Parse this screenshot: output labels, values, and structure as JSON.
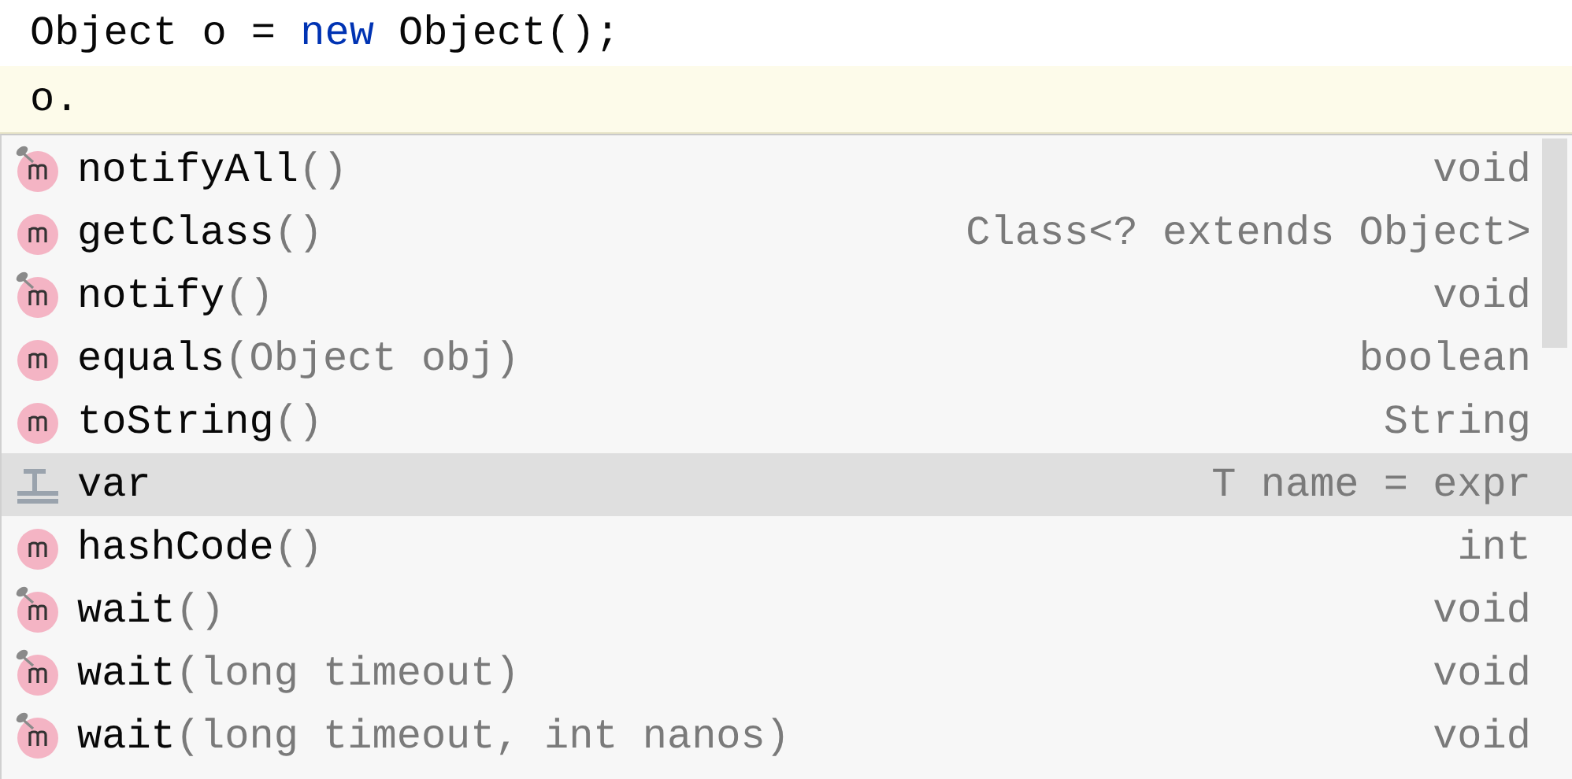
{
  "editor": {
    "lines": [
      {
        "tokens": [
          {
            "text": "Object o = ",
            "kind": "plain"
          },
          {
            "text": "new",
            "kind": "keyword"
          },
          {
            "text": " Object();",
            "kind": "plain"
          }
        ],
        "current": false
      },
      {
        "tokens": [
          {
            "text": "o.",
            "kind": "plain"
          }
        ],
        "current": true
      }
    ]
  },
  "completion": {
    "items": [
      {
        "kind": "method",
        "final": true,
        "name": "notifyAll",
        "params": "()",
        "type": "void",
        "selected": false
      },
      {
        "kind": "method",
        "final": false,
        "name": "getClass",
        "params": "()",
        "type": "Class<? extends Object>",
        "selected": false
      },
      {
        "kind": "method",
        "final": true,
        "name": "notify",
        "params": "()",
        "type": "void",
        "selected": false
      },
      {
        "kind": "method",
        "final": false,
        "name": "equals",
        "params": "(Object obj)",
        "type": "boolean",
        "selected": false
      },
      {
        "kind": "method",
        "final": false,
        "name": "toString",
        "params": "()",
        "type": "String",
        "selected": false
      },
      {
        "kind": "template",
        "name": "var",
        "type": "T name = expr",
        "selected": true
      },
      {
        "kind": "method",
        "final": false,
        "name": "hashCode",
        "params": "()",
        "type": "int",
        "selected": false
      },
      {
        "kind": "method",
        "final": true,
        "name": "wait",
        "params": "()",
        "type": "void",
        "selected": false
      },
      {
        "kind": "method",
        "final": true,
        "name": "wait",
        "params": "(long timeout)",
        "type": "void",
        "selected": false
      },
      {
        "kind": "method",
        "final": true,
        "name": "wait",
        "params": "(long timeout, int nanos)",
        "type": "void",
        "selected": false
      }
    ]
  }
}
